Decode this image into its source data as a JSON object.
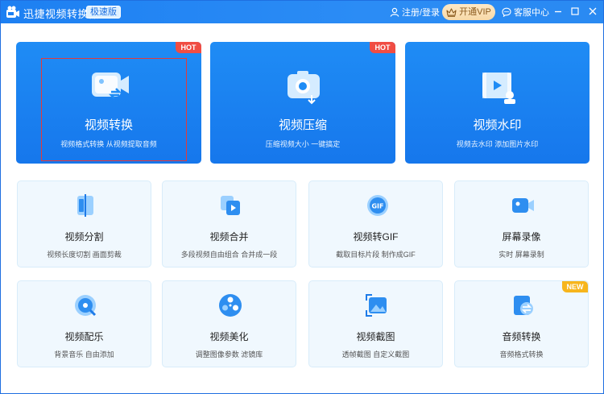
{
  "titlebar": {
    "title": "迅捷视频转换器",
    "badge": "极速版",
    "login": "注册/登录",
    "vip": "开通VIP",
    "service": "客服中心"
  },
  "big_cards": [
    {
      "title": "视频转换",
      "desc": "视频格式转换 从视频提取音频",
      "tag": "HOT",
      "icon": "video-convert-icon"
    },
    {
      "title": "视频压缩",
      "desc": "压缩视频大小 一键搞定",
      "tag": "HOT",
      "icon": "video-compress-icon"
    },
    {
      "title": "视频水印",
      "desc": "视频去水印 添加图片水印",
      "tag": "",
      "icon": "video-watermark-icon"
    }
  ],
  "cards": [
    {
      "title": "视频分割",
      "desc": "视频长度切割 画面剪裁",
      "icon": "video-split-icon"
    },
    {
      "title": "视频合并",
      "desc": "多段视频自由组合 合并成一段",
      "icon": "video-merge-icon"
    },
    {
      "title": "视频转GIF",
      "desc": "截取目标片段 制作成GIF",
      "icon": "video-gif-icon"
    },
    {
      "title": "屏幕录像",
      "desc": "实时 屏幕录制",
      "icon": "screen-record-icon"
    },
    {
      "title": "视频配乐",
      "desc": "背景音乐 自由添加",
      "icon": "video-music-icon"
    },
    {
      "title": "视频美化",
      "desc": "调整图像参数 滤镜库",
      "icon": "video-beautify-icon"
    },
    {
      "title": "视频截图",
      "desc": "透帧截图 自定义截图",
      "icon": "video-screenshot-icon"
    },
    {
      "title": "音频转换",
      "desc": "音频格式转换",
      "tag": "NEW",
      "icon": "audio-convert-icon"
    }
  ],
  "colors": {
    "accent": "#1f8cf5",
    "hot": "#f04d43",
    "new": "#f7b51c",
    "vip": "#f7d9a8"
  }
}
